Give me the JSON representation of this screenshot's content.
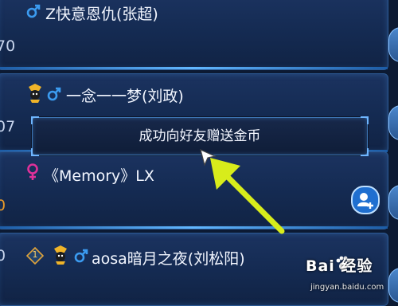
{
  "rows": [
    {
      "name": "Z快意恩仇(张超)",
      "number": "70"
    },
    {
      "name": "一念一一梦(刘政)",
      "number": "07"
    },
    {
      "name": "《Memory》LX",
      "number": "0"
    },
    {
      "name": "aosa暗月之夜(刘松阳)",
      "number": "0",
      "rank_level": "1"
    }
  ],
  "toast": {
    "text": "成功向好友赠送金币"
  },
  "watermark": {
    "title": "Bai 经验",
    "url": "jingyan.baidu.com"
  },
  "colors": {
    "male": "#3b9bf0",
    "female": "#e0319a",
    "arrow": "#d8ec1b",
    "number_orange": "#e99a2a"
  }
}
